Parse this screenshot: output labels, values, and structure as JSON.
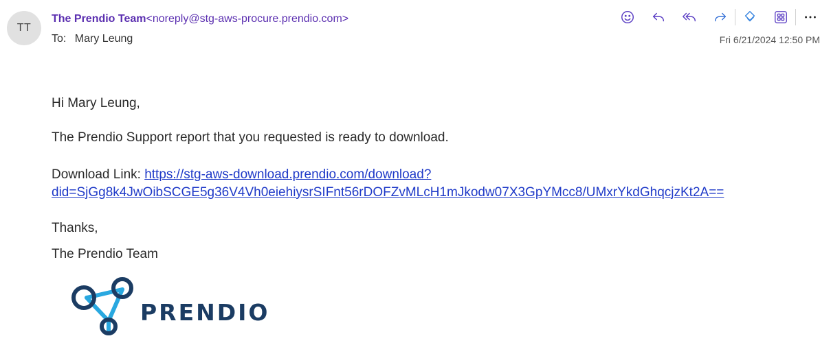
{
  "sender": {
    "avatar_initials": "TT",
    "name": "The Prendio Team",
    "address": "<noreply@stg-aws-procure.prendio.com>"
  },
  "recipient": {
    "label": "To:",
    "name": "Mary Leung"
  },
  "toolbar": {
    "icons": [
      "emoji-icon",
      "reply-icon",
      "reply-all-icon",
      "forward-icon",
      "copilot-icon",
      "apps-icon",
      "more-icon"
    ]
  },
  "date": "Fri 6/21/2024 12:50 PM",
  "body": {
    "greeting": "Hi Mary Leung,",
    "report_line": "The Prendio Support report that you requested is ready to download.",
    "download_label": "Download Link:",
    "download_link_part1": "https://stg-aws-download.prendio.com/download?",
    "download_link_part2": "did=SjGg8k4JwOibSCGE5g36V4Vh0eiehiysrSIFnt56rDOFZvMLcH1mJkodw07X3GpYMcc8/UMxrYkdGhqcjzKt2A==",
    "thanks": "Thanks,",
    "signoff": "The Prendio Team"
  },
  "logo": {
    "text": "PRENDIO",
    "colors": {
      "dark": "#1b3c63",
      "light": "#29a8e0"
    }
  }
}
